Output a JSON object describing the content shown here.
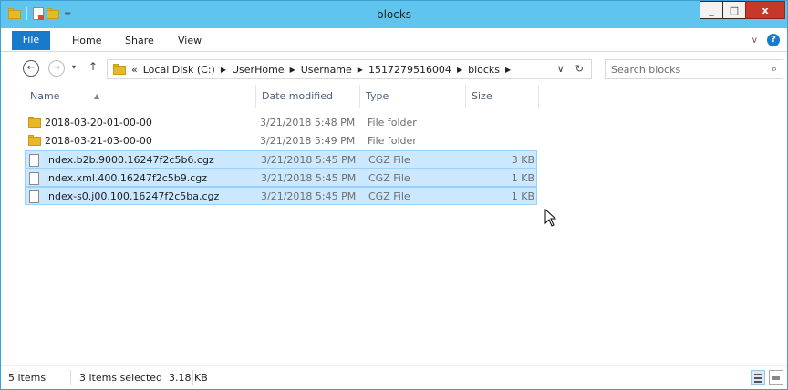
{
  "titlebar": {
    "title": "blocks",
    "qat_dropdown": "=",
    "minimize": "_",
    "maximize": "□",
    "close": "x"
  },
  "ribbon": {
    "tabs": [
      "File",
      "Home",
      "Share",
      "View"
    ],
    "expand": "∨",
    "help": "?"
  },
  "nav": {
    "back": "←",
    "forward": "→",
    "recent": "▾",
    "up": "↑"
  },
  "address": {
    "overflow": "«",
    "crumbs": [
      "Local Disk (C:)",
      "UserHome",
      "Username",
      "1517279516004",
      "blocks"
    ],
    "dropdown": "∨",
    "refresh": "↻"
  },
  "search": {
    "placeholder": "Search blocks",
    "icon": "⌕"
  },
  "columns": {
    "name": "Name",
    "date": "Date modified",
    "type": "Type",
    "size": "Size"
  },
  "rows": [
    {
      "name": "2018-03-20-01-00-00",
      "date": "3/21/2018 5:48 PM",
      "type": "File folder",
      "size": "",
      "icon": "folder-icon",
      "selected": false
    },
    {
      "name": "2018-03-21-03-00-00",
      "date": "3/21/2018 5:49 PM",
      "type": "File folder",
      "size": "",
      "icon": "folder-icon",
      "selected": false
    },
    {
      "name": "index.b2b.9000.16247f2c5b6.cgz",
      "date": "3/21/2018 5:45 PM",
      "type": "CGZ File",
      "size": "3 KB",
      "icon": "file-icon",
      "selected": true
    },
    {
      "name": "index.xml.400.16247f2c5b9.cgz",
      "date": "3/21/2018 5:45 PM",
      "type": "CGZ File",
      "size": "1 KB",
      "icon": "file-icon",
      "selected": true
    },
    {
      "name": "index-s0.j00.100.16247f2c5ba.cgz",
      "date": "3/21/2018 5:45 PM",
      "type": "CGZ File",
      "size": "1 KB",
      "icon": "file-icon",
      "selected": true
    }
  ],
  "status": {
    "items": "5 items",
    "selected": "3 items selected  3.18 KB"
  },
  "colors": {
    "titlebar": "#5fc5ee",
    "file_tab": "#1979ca",
    "selection": "#cce8ff",
    "close": "#c7382b"
  }
}
